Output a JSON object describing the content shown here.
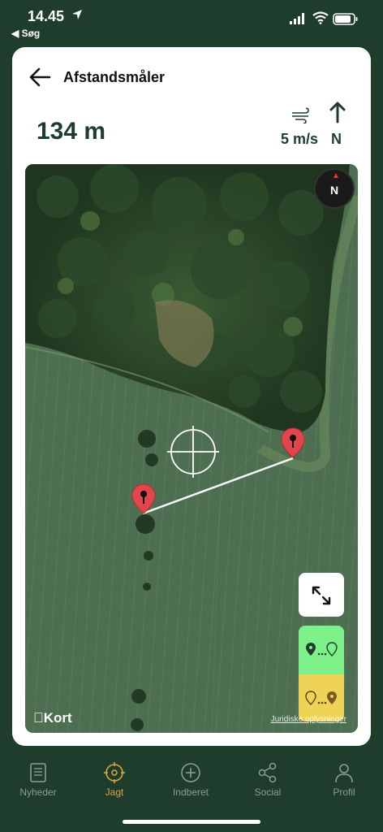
{
  "status_bar": {
    "time": "14.45",
    "back_app": "◀ Søg"
  },
  "header": {
    "title": "Afstandsmåler",
    "back_icon": "arrow-left-icon"
  },
  "measure": {
    "distance": "134 m",
    "wind_speed": "5 m/s",
    "wind_direction": "N"
  },
  "map": {
    "compass_label": "N",
    "attribution": "Kort",
    "legal_link": "Juridiske oplysninger",
    "pin_color": "#e0474c",
    "mode_a_color": "#7ef08a",
    "mode_b_color": "#efd356"
  },
  "tabs": [
    {
      "label": "Nyheder",
      "icon": "newspaper-icon",
      "active": false
    },
    {
      "label": "Jagt",
      "icon": "target-icon",
      "active": true
    },
    {
      "label": "Indberet",
      "icon": "plus-circle-icon",
      "active": false
    },
    {
      "label": "Social",
      "icon": "share-icon",
      "active": false
    },
    {
      "label": "Profil",
      "icon": "person-icon",
      "active": false
    }
  ],
  "colors": {
    "brand": "#1f3d2c",
    "active_tab": "#d9a441"
  }
}
